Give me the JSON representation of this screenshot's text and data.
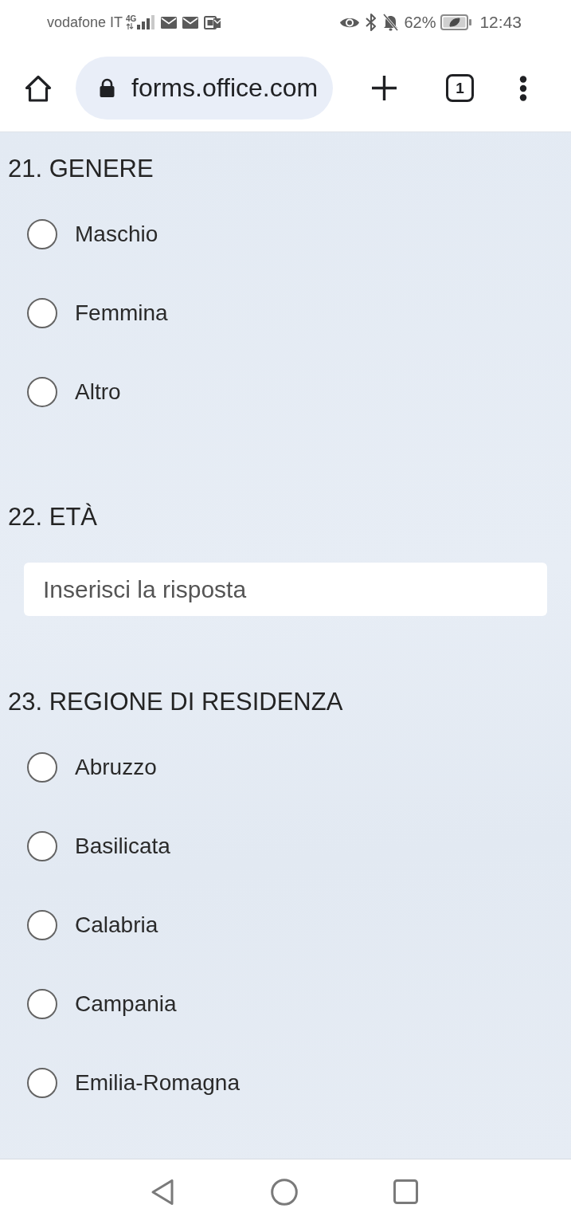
{
  "status_bar": {
    "carrier": "vodafone IT",
    "network": "4G",
    "battery": "62%",
    "time": "12:43"
  },
  "browser": {
    "url": "forms.office.com",
    "tab_count": "1"
  },
  "questions": [
    {
      "title": "21. GENERE",
      "kind": "choice",
      "options": [
        {
          "label": "Maschio",
          "selected": false
        },
        {
          "label": "Femmina",
          "selected": false
        },
        {
          "label": "Altro",
          "selected": false
        }
      ]
    },
    {
      "title": "22. ETÀ",
      "kind": "text",
      "placeholder": "Inserisci la risposta"
    },
    {
      "title": "23. REGIONE DI RESIDENZA",
      "kind": "choice",
      "options": [
        {
          "label": "Abruzzo",
          "selected": false
        },
        {
          "label": "Basilicata",
          "selected": false
        },
        {
          "label": "Calabria",
          "selected": false
        },
        {
          "label": "Campania",
          "selected": false
        },
        {
          "label": "Emilia-Romagna",
          "selected": false
        }
      ]
    }
  ]
}
